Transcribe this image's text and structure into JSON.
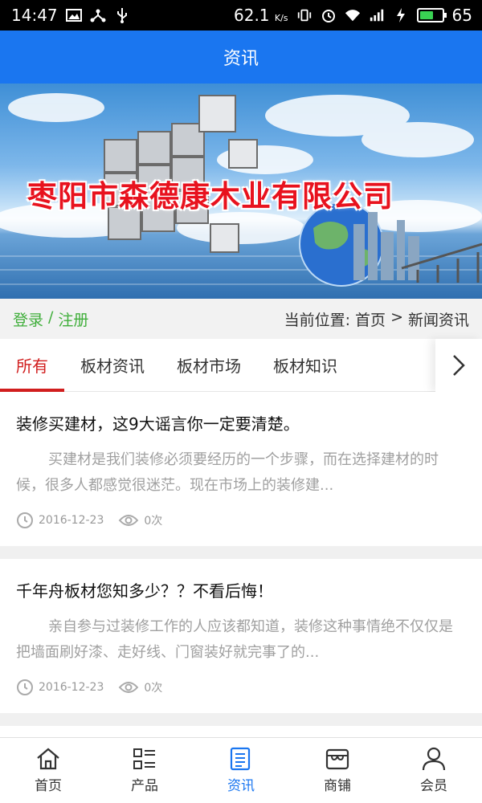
{
  "status_bar": {
    "time": "14:47",
    "speed": "62.1",
    "speed_unit": "K/s",
    "battery_level": "65"
  },
  "header": {
    "title": "资讯"
  },
  "banner": {
    "company_name": "枣阳市森德康木业有限公司"
  },
  "info_row": {
    "login": "登录",
    "separator": "/",
    "register": "注册",
    "location_label": "当前位置:",
    "breadcrumb_home": "首页",
    "breadcrumb_sep": ">",
    "breadcrumb_current": "新闻资讯"
  },
  "tabs": [
    {
      "label": "所有",
      "active": true
    },
    {
      "label": "板材资讯",
      "active": false
    },
    {
      "label": "板材市场",
      "active": false
    },
    {
      "label": "板材知识",
      "active": false
    }
  ],
  "articles": [
    {
      "title": "装修买建材，这9大谣言你一定要清楚。",
      "summary": "买建材是我们装修必须要经历的一个步骤，而在选择建材的时候，很多人都感觉很迷茫。现在市场上的装修建...",
      "date": "2016-12-23",
      "views": "0次"
    },
    {
      "title": "千年舟板材您知多少？？不看后悔！",
      "summary": "亲自参与过装修工作的人应该都知道，装修这种事情绝不仅仅是把墙面刷好漆、走好线、门窗装好就完事了的...",
      "date": "2016-12-23",
      "views": "0次"
    }
  ],
  "bottom_nav": [
    {
      "label": "首页",
      "icon": "home-icon",
      "active": false
    },
    {
      "label": "产品",
      "icon": "list-icon",
      "active": false
    },
    {
      "label": "资讯",
      "icon": "news-icon",
      "active": true
    },
    {
      "label": "商铺",
      "icon": "shop-icon",
      "active": false
    },
    {
      "label": "会员",
      "icon": "user-icon",
      "active": false
    }
  ],
  "colors": {
    "header_bg": "#1a76f0",
    "active_tab": "#d11e1e",
    "login_green": "#3fae3a",
    "active_nav": "#1a76f0"
  }
}
